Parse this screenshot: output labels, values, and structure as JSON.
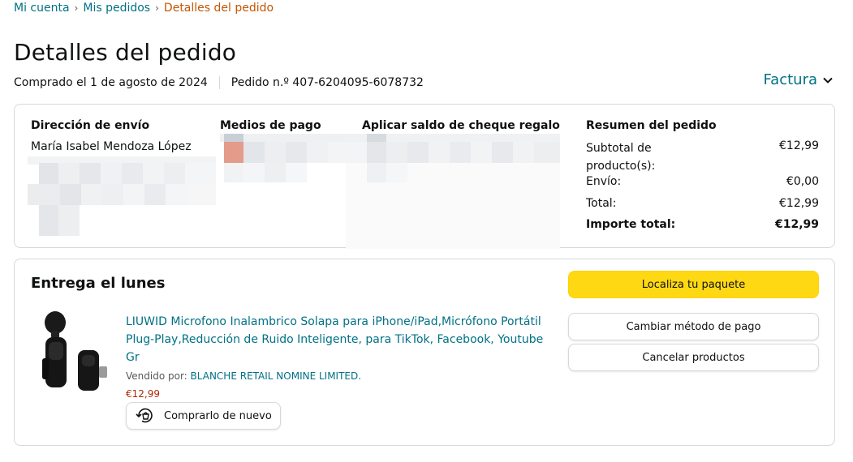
{
  "breadcrumb": {
    "items": [
      "Mi cuenta",
      "Mis pedidos"
    ],
    "separator": "›",
    "current": "Detalles del pedido"
  },
  "page": {
    "title": "Detalles del pedido",
    "purchased": "Comprado el 1 de agosto de 2024",
    "order_number": "Pedido n.º 407-6204095-6078732",
    "invoice_label": "Factura"
  },
  "shipping": {
    "title": "Dirección de envío",
    "name": "María Isabel Mendoza López"
  },
  "payment": {
    "title": "Medios de pago"
  },
  "gift": {
    "title": "Aplicar saldo de cheque regalo"
  },
  "summary": {
    "title": "Resumen del pedido",
    "rows": [
      {
        "label": "Subtotal de producto(s):",
        "value": "€12,99"
      },
      {
        "label": "Envío:",
        "value": "€0,00"
      },
      {
        "label": "Total:",
        "value": "€12,99"
      },
      {
        "label": "Importe total:",
        "value": "€12,99"
      }
    ]
  },
  "delivery": {
    "title": "Entrega el lunes",
    "product": {
      "title": "LIUWID Microfono Inalambrico Solapa para iPhone/iPad,Micrófono Portátil Plug-Play,Reducción de Ruido Inteligente, para TikTok, Facebook, Youtube Gr",
      "sold_by_label": "Vendido por:",
      "seller": "BLANCHE RETAIL NOMINE LIMITED.",
      "price": "€12,99",
      "buy_again": "Comprarlo de nuevo"
    },
    "buttons": {
      "track": "Localiza tu paquete",
      "change_payment": "Cambiar método de pago",
      "cancel": "Cancelar productos"
    }
  },
  "colors": {
    "link": "#007185",
    "current_breadcrumb": "#c45500",
    "price": "#b12704",
    "primary_button": "#ffd814",
    "border": "#d5d9d9"
  }
}
